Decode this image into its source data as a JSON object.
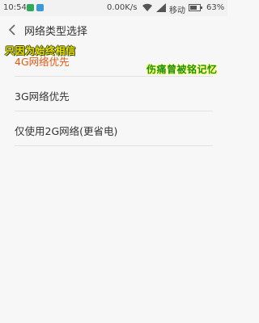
{
  "status_bar": {
    "time": "10:54",
    "speed": "0.00K/s",
    "carrier": "移动",
    "battery": "63%",
    "icons": [
      "app-notification-icon-green",
      "app-notification-icon-blue",
      "wifi-icon",
      "signal-icon",
      "battery-icon"
    ],
    "colors": {
      "app1": "#2eaa5b",
      "app2": "#3a9ad9"
    }
  },
  "header": {
    "title": "网络类型选择",
    "back_icon": "chevron-left-icon"
  },
  "overlay_captions": {
    "left": "只因为始终相信",
    "right": "伤痛曾被铭记忆"
  },
  "options": [
    {
      "label": "4G网络优先",
      "selected": true
    },
    {
      "label": "3G网络优先",
      "selected": false
    },
    {
      "label": "仅使用2G网络(更省电)",
      "selected": false
    }
  ],
  "colors": {
    "accent": "#e05a10",
    "background": "#f7f7f7",
    "divider": "#e2e2e2"
  }
}
